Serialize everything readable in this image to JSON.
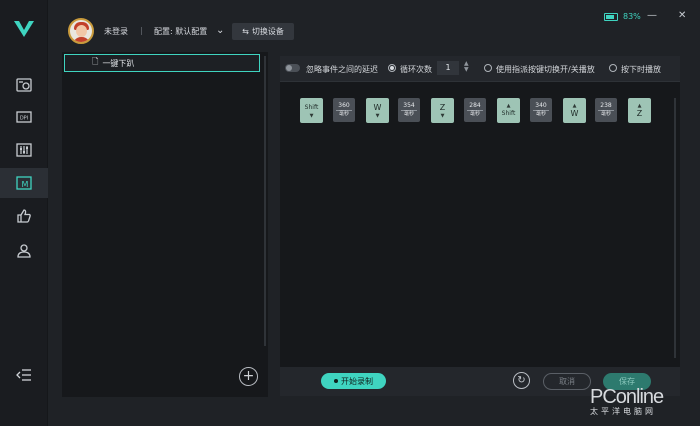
{
  "app": {
    "logo_icon": "v-logo-icon",
    "accent_color": "#3fd4c0"
  },
  "sidebar": {
    "items": [
      {
        "icon": "mouse-settings-icon"
      },
      {
        "icon": "dpi-icon",
        "label": "DPI"
      },
      {
        "icon": "equalizer-icon"
      },
      {
        "icon": "macro-icon",
        "label": "M",
        "active": true
      },
      {
        "icon": "thumb-up-icon"
      },
      {
        "icon": "user-settings-icon"
      }
    ],
    "collapse_icon": "collapse-menu-icon"
  },
  "header": {
    "login_status": "未登录",
    "separator": "|",
    "config_label": "配置: 默认配置",
    "switch_device_label": "切换设备",
    "battery_percent": "83%",
    "battery_level": 0.83
  },
  "macro_list": {
    "items": [
      {
        "label": "一键下趴"
      }
    ]
  },
  "options": {
    "ignore_delay_label": "忽略事件之间的延迟",
    "loop_label": "循环次数",
    "loop_count": "1",
    "toggle_play_label": "使用指派按键切换开/关播放",
    "hold_play_label": "按下时播放"
  },
  "events": [
    {
      "type": "key",
      "label": "Shift",
      "dir": "down"
    },
    {
      "type": "delay",
      "value": "360",
      "unit": "毫秒"
    },
    {
      "type": "key",
      "label": "W",
      "dir": "down"
    },
    {
      "type": "delay",
      "value": "354",
      "unit": "毫秒"
    },
    {
      "type": "key",
      "label": "Z",
      "dir": "down"
    },
    {
      "type": "delay",
      "value": "284",
      "unit": "毫秒"
    },
    {
      "type": "key",
      "label": "Shift",
      "dir": "up"
    },
    {
      "type": "delay",
      "value": "340",
      "unit": "毫秒"
    },
    {
      "type": "key",
      "label": "W",
      "dir": "up"
    },
    {
      "type": "delay",
      "value": "238",
      "unit": "毫秒"
    },
    {
      "type": "key",
      "label": "Z",
      "dir": "up"
    }
  ],
  "actions": {
    "record_label": "开始录制",
    "cancel_label": "取消",
    "save_label": "保存"
  },
  "watermark": {
    "brand": "PConline",
    "sub": "太平洋电脑网"
  }
}
